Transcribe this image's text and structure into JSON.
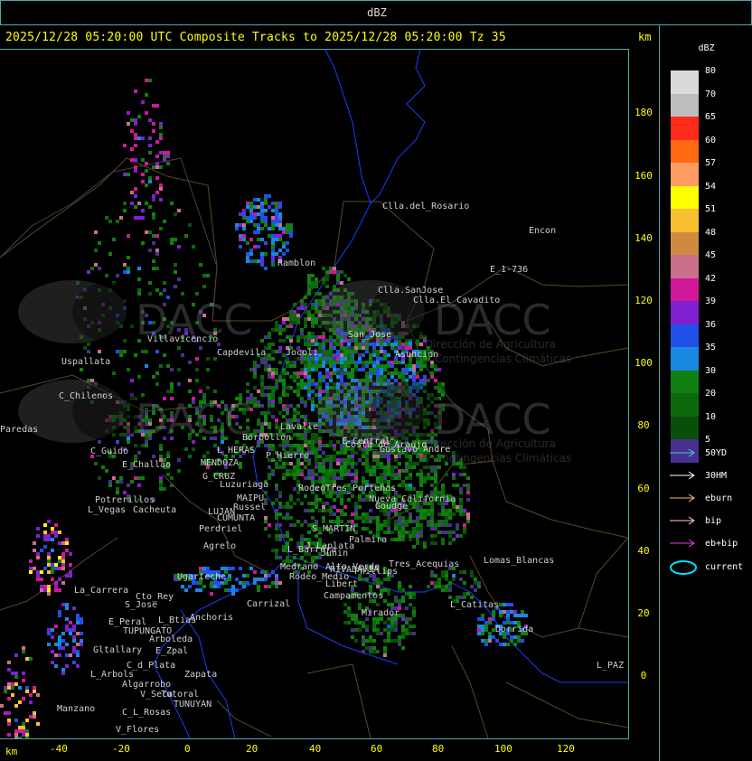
{
  "window_title": "dBZ",
  "header": "2025/12/28 05:20:00 UTC Composite Tracks to 2025/12/28 05:20:00 Tz 35",
  "km_label": "km",
  "y_ticks": [
    "180",
    "160",
    "140",
    "120",
    "100",
    "80",
    "60",
    "40",
    "20",
    "0"
  ],
  "x_ticks": [
    "-40",
    "-20",
    "0",
    "20",
    "40",
    "60",
    "80",
    "100",
    "120"
  ],
  "legend": {
    "title": "dBZ",
    "bins": [
      {
        "label": "80",
        "color": "#d9d9d9"
      },
      {
        "label": "70",
        "color": "#bdbdbd"
      },
      {
        "label": "65",
        "color": "#ff2a1a"
      },
      {
        "label": "60",
        "color": "#ff6a10"
      },
      {
        "label": "57",
        "color": "#ff9a60"
      },
      {
        "label": "54",
        "color": "#ffff00"
      },
      {
        "label": "51",
        "color": "#f8c030"
      },
      {
        "label": "48",
        "color": "#d08a40"
      },
      {
        "label": "45",
        "color": "#c8708a"
      },
      {
        "label": "42",
        "color": "#d01898"
      },
      {
        "label": "39",
        "color": "#8020d0"
      },
      {
        "label": "36",
        "color": "#2050e8"
      },
      {
        "label": "35",
        "color": "#1888e0"
      },
      {
        "label": "30",
        "color": "#108010"
      },
      {
        "label": "20",
        "color": "#0c6a0c"
      },
      {
        "label": "10",
        "color": "#0a4e0a"
      },
      {
        "label": "5",
        "color": "#483090"
      }
    ],
    "tracks": [
      {
        "label": "50YD",
        "color": "#40d0d0"
      },
      {
        "label": "30HM",
        "color": "#ffffff"
      },
      {
        "label": "eburn",
        "color": "#f0c070"
      },
      {
        "label": "bip",
        "color": "#ffd0d0"
      },
      {
        "label": "eb+bip",
        "color": "#e040e0"
      }
    ],
    "current_label": "current",
    "current_color": "#00e0ff"
  },
  "places": [
    "Clla.del_Rosario",
    "Encon",
    "E_1-736",
    "Ramblon",
    "Clla.SanJose",
    "Clla.El_Cavadito",
    "Villavicencio",
    "Uspallata",
    "Capdevila",
    "Jocoli",
    "Asuncion",
    "San_Jose",
    "C_Chilenos",
    "Paredas",
    "Borbollon",
    "L_HERAS",
    "P_Hierro",
    "C_Guido",
    "E_Challao",
    "MENDOZA",
    "G_CRUZ",
    "Luzuriaga",
    "Lavalle",
    "Tres_Porteñas",
    "Costa_de_Araujo",
    "E_Central",
    "Gustavo_Andre",
    "Rodeo",
    "Russel",
    "MAIPU",
    "LUJAN",
    "CUMUNTA",
    "Potrerillos",
    "L_Vegas",
    "Cacheuta",
    "Perdriel",
    "Agrelo",
    "L_Barrera",
    "Ugarteche",
    "La_Carrera",
    "Cto_Rey",
    "S_Jose",
    "E_Peral",
    "TUPUNGATO",
    "L_Btias",
    "Anchoris",
    "Gltallary",
    "E_Zpal",
    "Arboleda",
    "C_d_Plata",
    "Zapata",
    "Algarrobo",
    "L_Arbols",
    "V_Seca",
    "Totoral",
    "TUNUYAN",
    "Manzano",
    "C_L_Rosas",
    "V_Flores",
    "Medrano",
    "Rodeo_Medio",
    "Carrizal",
    "J_Laplata",
    "Alto_Verde",
    "Campamentos",
    "Mirador",
    "Libert",
    "Phillips",
    "S_MARTIN",
    "Palmira",
    "Junin",
    "RIVADAVIA",
    "Nueva_California",
    "L_Catitas",
    "Dorrida",
    "L_PAZ",
    "Lomas_Blancas",
    "Tres_Acequias",
    "Goudge"
  ],
  "watermark": {
    "brand": "DACC",
    "line1": "Dirección de Agricultura",
    "line2": "y Contingencias Climáticas"
  }
}
